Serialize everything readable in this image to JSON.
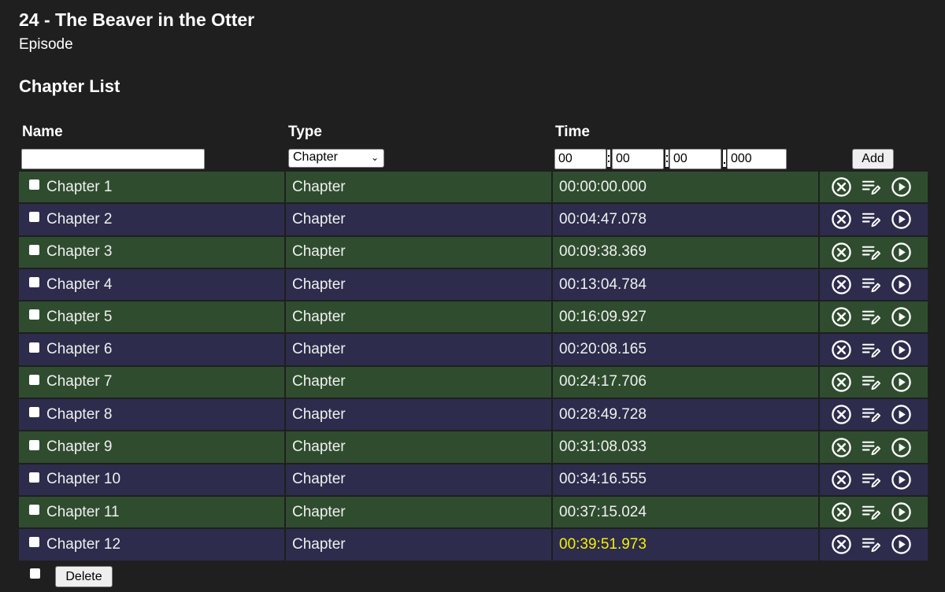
{
  "header": {
    "title": "24 - The Beaver in the Otter",
    "subtitle": "Episode"
  },
  "section_title": "Chapter List",
  "columns": {
    "name": "Name",
    "type": "Type",
    "time": "Time"
  },
  "add_form": {
    "name_value": "",
    "type_value": "Chapter",
    "hours": "00",
    "minutes": "00",
    "seconds": "00",
    "millis": "000",
    "add_label": "Add"
  },
  "chapters": [
    {
      "name": "Chapter 1",
      "type": "Chapter",
      "time": "00:00:00.000"
    },
    {
      "name": "Chapter 2",
      "type": "Chapter",
      "time": "00:04:47.078"
    },
    {
      "name": "Chapter 3",
      "type": "Chapter",
      "time": "00:09:38.369"
    },
    {
      "name": "Chapter 4",
      "type": "Chapter",
      "time": "00:13:04.784"
    },
    {
      "name": "Chapter 5",
      "type": "Chapter",
      "time": "00:16:09.927"
    },
    {
      "name": "Chapter 6",
      "type": "Chapter",
      "time": "00:20:08.165"
    },
    {
      "name": "Chapter 7",
      "type": "Chapter",
      "time": "00:24:17.706"
    },
    {
      "name": "Chapter 8",
      "type": "Chapter",
      "time": "00:28:49.728"
    },
    {
      "name": "Chapter 9",
      "type": "Chapter",
      "time": "00:31:08.033"
    },
    {
      "name": "Chapter 10",
      "type": "Chapter",
      "time": "00:34:16.555"
    },
    {
      "name": "Chapter 11",
      "type": "Chapter",
      "time": "00:37:15.024"
    },
    {
      "name": "Chapter 12",
      "type": "Chapter",
      "time": "00:39:51.973",
      "highlighted": true
    }
  ],
  "footer": {
    "delete_label": "Delete"
  },
  "colors": {
    "row_green": "#2f4c2f",
    "row_purple": "#2d2c4c",
    "background": "#1f1f1f",
    "highlight_text": "#f4f000"
  },
  "row_icons": [
    "remove-circle-x-icon",
    "edit-list-icon",
    "play-circle-icon"
  ]
}
